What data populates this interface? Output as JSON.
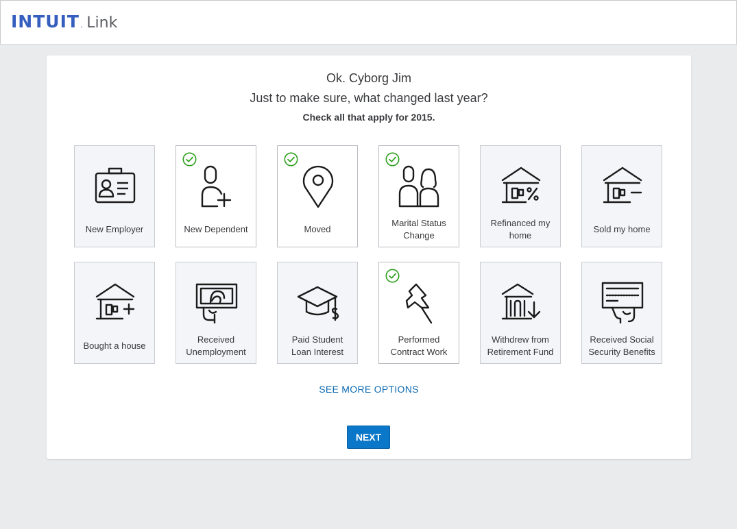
{
  "header": {
    "brand": "INTUIT",
    "product": "Link"
  },
  "main": {
    "greeting": "Ok. Cyborg Jim",
    "question": "Just to make sure, what changed last year?",
    "instruction": "Check all that apply for 2015.",
    "see_more": "SEE MORE OPTIONS",
    "next": "NEXT"
  },
  "tiles": [
    {
      "label": "New Employer",
      "icon": "id-badge-icon",
      "selected": false
    },
    {
      "label": "New Dependent",
      "icon": "add-person-icon",
      "selected": true
    },
    {
      "label": "Moved",
      "icon": "location-pin-icon",
      "selected": true
    },
    {
      "label": "Marital Status Change",
      "icon": "couple-icon",
      "selected": true
    },
    {
      "label": "Refinanced my home",
      "icon": "house-percent-icon",
      "selected": false
    },
    {
      "label": "Sold my home",
      "icon": "house-minus-icon",
      "selected": false
    },
    {
      "label": "Bought a house",
      "icon": "house-plus-icon",
      "selected": false
    },
    {
      "label": "Received Unemployment",
      "icon": "money-hand-icon",
      "selected": false
    },
    {
      "label": "Paid Student Loan Interest",
      "icon": "graduation-cap-icon",
      "selected": false
    },
    {
      "label": "Performed Contract Work",
      "icon": "pushpin-icon",
      "selected": true
    },
    {
      "label": "Withdrew from Retirement Fund",
      "icon": "bank-withdraw-icon",
      "selected": false
    },
    {
      "label": "Received Social Security Benefits",
      "icon": "check-hand-icon",
      "selected": false
    }
  ],
  "colors": {
    "brand": "#365ebf",
    "accent": "#0a77c8",
    "check": "#2ca01c",
    "link": "#0c6ab2"
  }
}
